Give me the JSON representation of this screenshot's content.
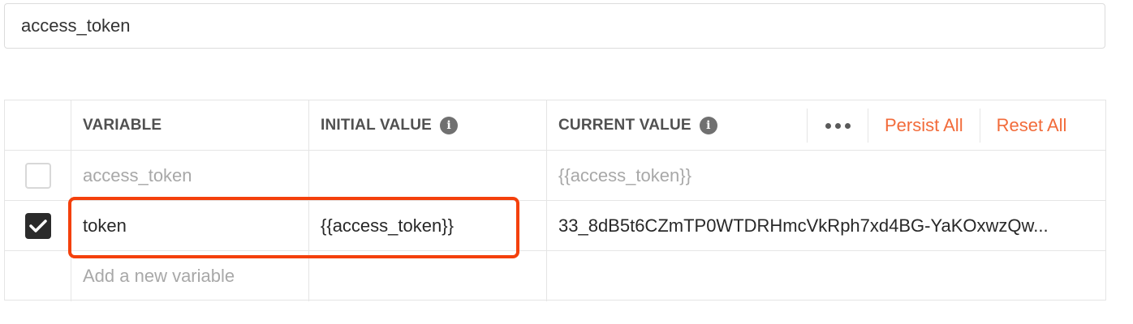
{
  "env_name": {
    "value": "access_token"
  },
  "table": {
    "headers": {
      "variable": "VARIABLE",
      "initial_value": "INITIAL VALUE",
      "current_value": "CURRENT VALUE"
    },
    "actions": {
      "more_icon": "more-dots-icon",
      "persist_all": "Persist All",
      "reset_all": "Reset All"
    },
    "rows": [
      {
        "enabled": false,
        "variable": "access_token",
        "initial_value": "",
        "current_value": "{{access_token}}"
      },
      {
        "enabled": true,
        "variable": "token",
        "initial_value": "{{access_token}}",
        "current_value": "33_8dB5t6CZmTP0WTDRHmcVkRph7xd4BG-YaKOxwzQw..."
      }
    ],
    "new_row": {
      "placeholder": "Add a new variable"
    }
  },
  "colors": {
    "accent": "#f26b3a",
    "highlight": "#f4400b",
    "checked": "#2b2b2b"
  }
}
